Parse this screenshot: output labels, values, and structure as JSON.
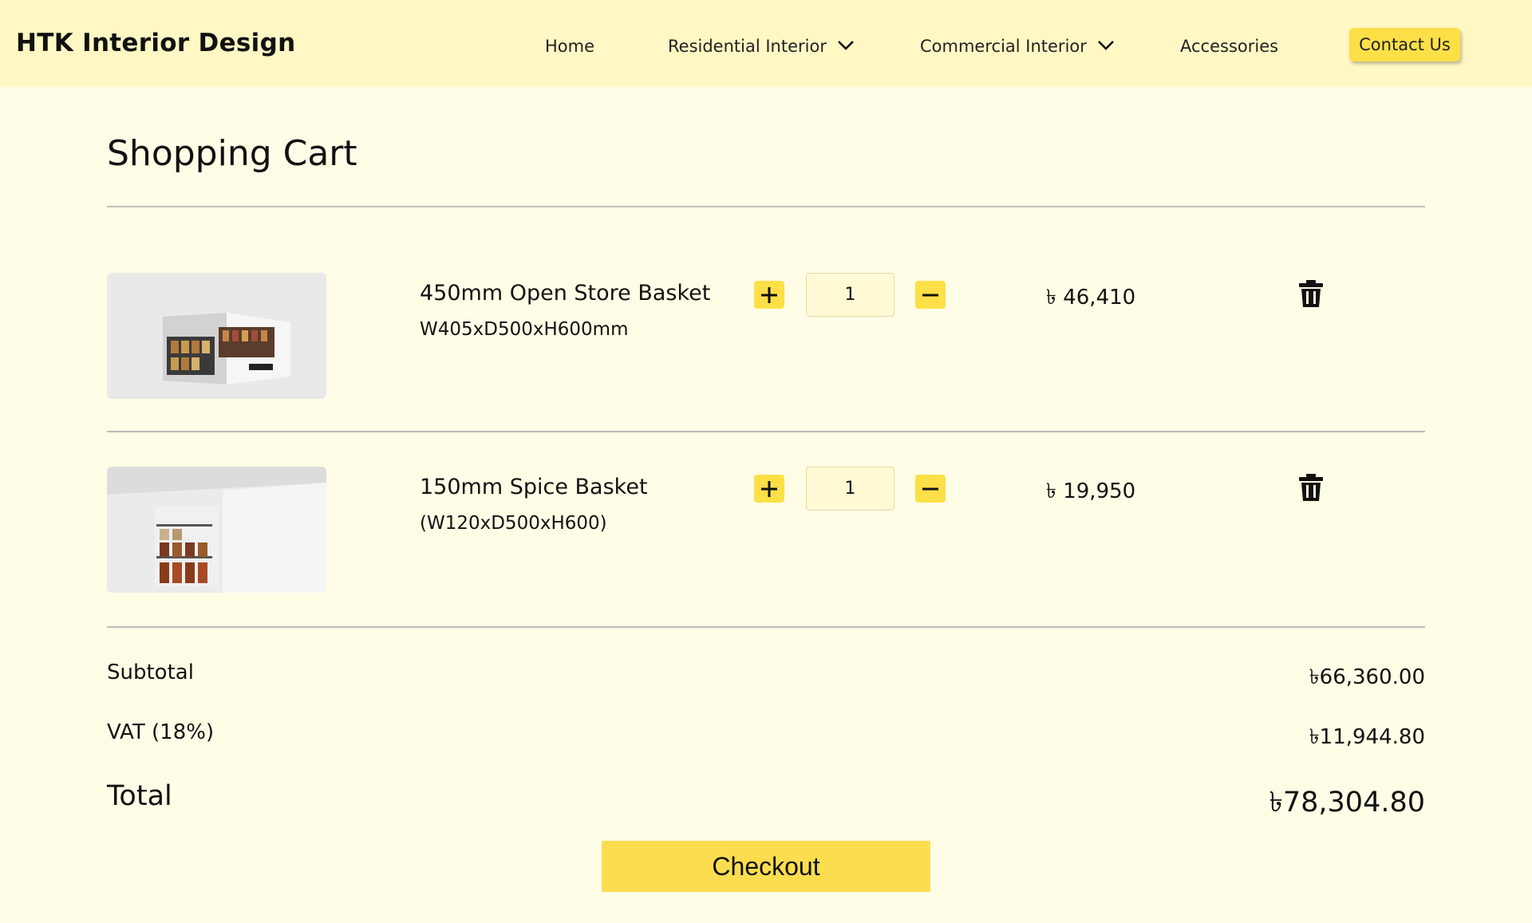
{
  "header": {
    "brand": "HTK Interior Design",
    "nav": {
      "home": "Home",
      "residential": "Residential Interior",
      "commercial": "Commercial Interior",
      "accessories": "Accessories"
    },
    "contact": "Contact Us"
  },
  "cart": {
    "title": "Shopping Cart",
    "items": [
      {
        "name": "450mm Open Store Basket",
        "dims": "W405xD500xH600mm",
        "quantity": "1",
        "price": "৳ 46,410"
      },
      {
        "name": "150mm Spice Basket",
        "dims": "(W120xD500xH600)",
        "quantity": "1",
        "price": "৳ 19,950"
      }
    ]
  },
  "summary": {
    "subtotal_label": "Subtotal",
    "subtotal": "৳66,360.00",
    "vat_label": "VAT (18%)",
    "vat": "৳11,944.80",
    "total_label": "Total",
    "total": "৳78,304.80"
  },
  "checkout_label": "Checkout",
  "colors": {
    "page_bg": "#fffde6",
    "header_bg": "#fff7c4",
    "accent": "#fde047"
  },
  "icons": [
    "chevron-down-icon",
    "plus-icon",
    "minus-icon",
    "trash-icon"
  ]
}
